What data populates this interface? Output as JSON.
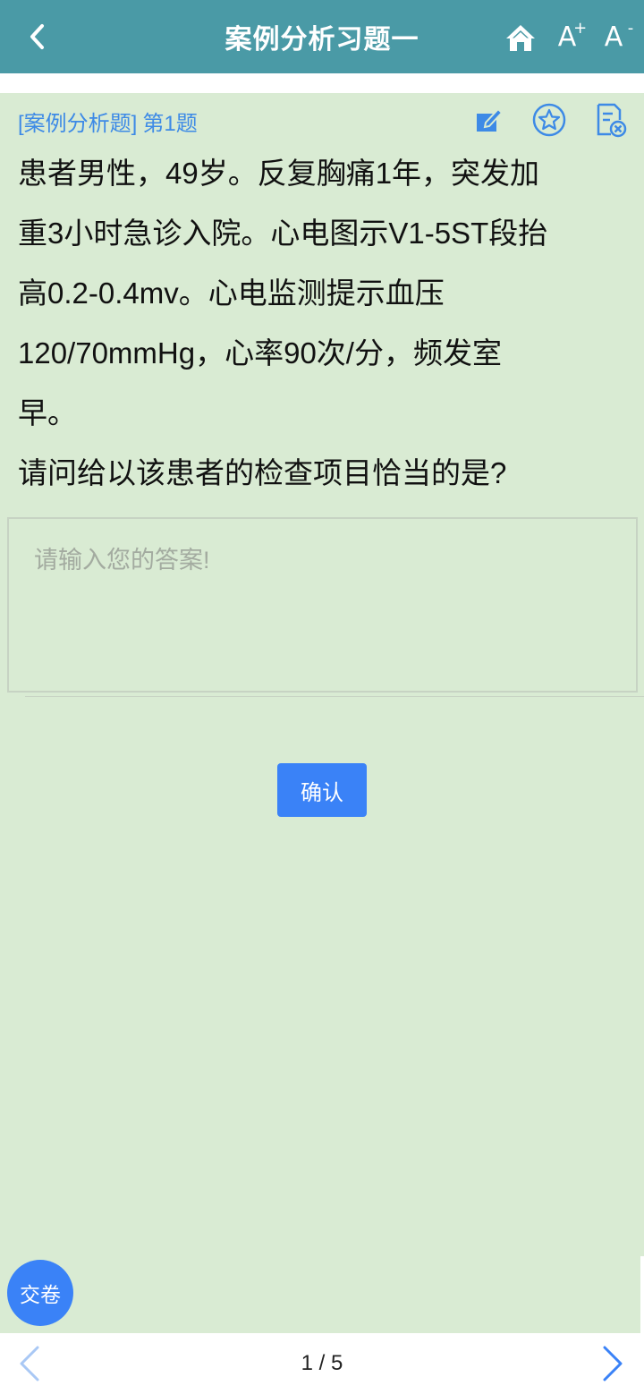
{
  "header": {
    "title": "案例分析习题一",
    "back_icon": "chevron-left-icon",
    "home_icon": "home-icon",
    "font_increase_label": "A",
    "font_increase_mark": "+",
    "font_decrease_label": "A",
    "font_decrease_mark": "-"
  },
  "question": {
    "type_label": "[案例分析题]",
    "number_label": "第1题",
    "lines": [
      "患者男性，49岁。反复胸痛1年，突发加",
      "重3小时急诊入院。心电图示V1-5ST段抬",
      "高0.2-0.4mv。心电监测提示血压",
      "120/70mmHg，心率90次/分，频发室",
      "早。",
      "请问给以该患者的检查项目恰当的是?"
    ]
  },
  "toolbar": {
    "edit_icon": "edit-icon",
    "favorite_icon": "star-icon",
    "clear_icon": "clear-doc-icon"
  },
  "answer": {
    "placeholder": "请输入您的答案!",
    "value": ""
  },
  "actions": {
    "confirm_label": "确认",
    "submit_label": "交卷"
  },
  "pagination": {
    "current": 1,
    "total": 5,
    "text": "1 / 5"
  },
  "colors": {
    "header_bg": "#4a9aa6",
    "content_bg": "#d9ebd3",
    "accent": "#3a82f7",
    "link_blue": "#3d8ae6"
  }
}
